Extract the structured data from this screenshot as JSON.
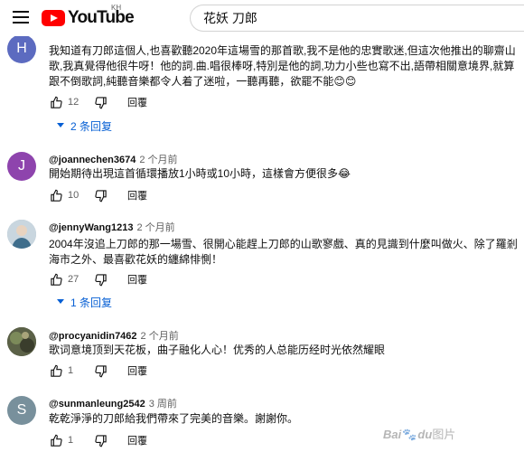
{
  "header": {
    "logo_text": "YouTube",
    "country_code": "KH",
    "search_query": "花妖 刀郎"
  },
  "comments": [
    {
      "avatar_letter": "H",
      "avatar_color": "#5c6bc0",
      "body": "我知道有刀郎這個人,也喜歡聽2020年這場雪的那首歌,我不是他的忠實歌迷,但這次他推出的聊齋山歌,我真覺得他很牛呀！他的詞.曲.唱很棒呀,特別是他的詞,功力小些也寫不出,語帶相關意境界,就算跟不倒歌詞,純聽音樂都令人着了迷啦，一聽再聽，欲罷不能😊😊",
      "likes": "12",
      "reply_label": "回覆",
      "replies_label": "2 条回复"
    },
    {
      "author": "@joannechen3674",
      "time": "2 个月前",
      "avatar_letter": "J",
      "avatar_color": "#8e44ad",
      "body": "開始期待出現這首循環播放1小時或10小時，這樣會方便很多😂",
      "likes": "10",
      "reply_label": "回覆"
    },
    {
      "author": "@jennyWang1213",
      "time": "2 个月前",
      "avatar_color": "#9fb7c7",
      "body": "2004年沒追上刀郎的那一場雪、很開心能趕上刀郎的山歌寥戲、真的見識到什麼叫做火、除了羅剎海市之外、最喜歡花妖的纏綿悱惻！",
      "likes": "27",
      "reply_label": "回覆",
      "replies_label": "1 条回复"
    },
    {
      "author": "@procyanidin7462",
      "time": "2 个月前",
      "avatar_color": "#4a4f3c",
      "body": "歌词意境顶到天花板，曲子融化人心！优秀的人总能历经时光依然耀眼",
      "likes": "1",
      "reply_label": "回覆"
    },
    {
      "author": "@sunmanleung2542",
      "time": "3 周前",
      "avatar_letter": "S",
      "avatar_color": "#78909c",
      "body": "乾乾淨淨的刀郎給我們帶來了完美的音樂。謝謝你。",
      "likes": "1",
      "reply_label": "回覆"
    }
  ],
  "watermark": {
    "brand": "Bai",
    "brand_end": "du",
    "suffix": "图片"
  }
}
